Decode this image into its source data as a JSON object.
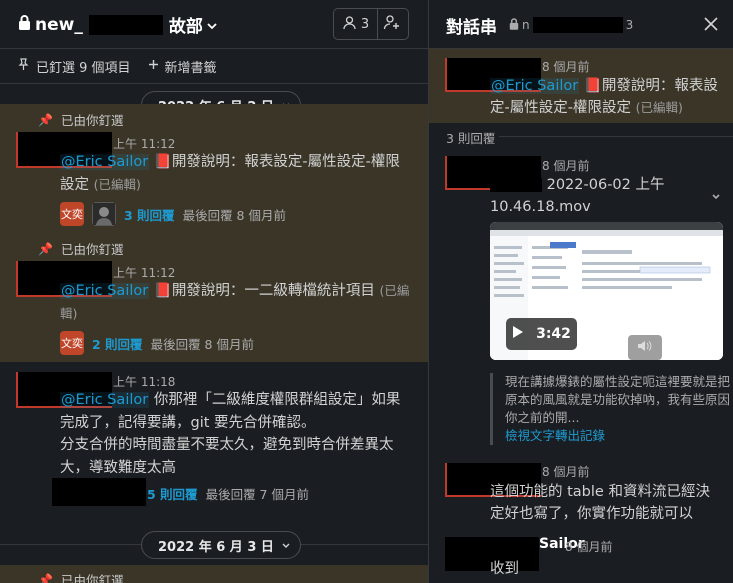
{
  "channel": {
    "title_prefix": "new_",
    "title_suffix": "故部",
    "member_count": "3",
    "pinned_text": "已釘選 9 個項目",
    "add_bookmark": "新增書籤"
  },
  "dates": [
    "2022 年 6 月 2 日",
    "2022 年 6 月 3 日"
  ],
  "messages": [
    {
      "pinned_label": "已由你釘選",
      "time": "上午 11:12",
      "mention": "@Eric Sailor",
      "text": "開發說明：報表設定-屬性設定-權限設定",
      "edited": "(已編輯)",
      "avatar_text": "文奕",
      "replies": "3 則回覆",
      "last_reply": "最後回覆 8 個月前"
    },
    {
      "pinned_label": "已由你釘選",
      "time": "上午 11:12",
      "mention": "@Eric Sailor",
      "text": "開發說明：一二級轉檔統計項目",
      "edited": "(已編輯)",
      "avatar_text": "文奕",
      "replies": "2 則回覆",
      "last_reply": "最後回覆 8 個月前"
    },
    {
      "time": "上午 11:18",
      "mention": "@Eric Sailor",
      "text": "你那裡「二級維度權限群組設定」如果完成了，記得要講，git 要先合併確認。",
      "text2": "分支合併的時間盡量不要太久，避免到時合併差異太大，導致難度太高",
      "replies": "5 則回覆",
      "last_reply": "最後回覆 7 個月前"
    },
    {
      "pinned_label": "已由你釘選"
    }
  ],
  "thread": {
    "title": "對話串",
    "channel_prefix": "n",
    "channel_suffix": "3",
    "root_time": "8 個月前",
    "root_mention": "@Eric Sailor",
    "root_text": "開發說明：報表設定-屬性設定-權限設定",
    "root_edited": "(已編輯)",
    "reply_count": "3 則回覆",
    "reply1_time": "8 個月前",
    "reply1_file": "2022-06-02 上午 10.46.18.mov",
    "video_duration": "3:42",
    "transcript": "現在講據爆錶的屬性設定呃這裡要就是把原本的風風就是功能砍掉吶，我有些原因你之前的開...",
    "transcript_link": "檢視文字轉出記錄",
    "reply2_time": "8 個月前",
    "reply2_text_a": "這個功能的 table 和資料流已經決定好也寫了，你實作功能就可以",
    "reply3_author_tail": "Sailor",
    "reply3_time": "8 個月前",
    "reply3_text": "收到"
  }
}
